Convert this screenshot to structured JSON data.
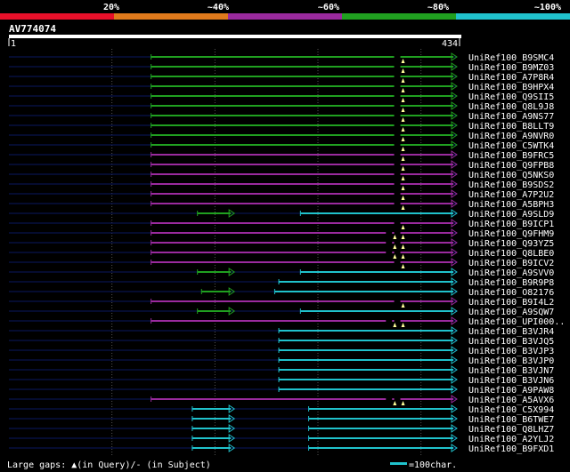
{
  "scale": {
    "labels": [
      "20%",
      "~40%",
      "~60%",
      "~80%",
      "~100%"
    ],
    "colors": [
      "#e8102a",
      "#e07a1c",
      "#9a2a9e",
      "#20a020",
      "#20c2cc"
    ]
  },
  "query": {
    "name": "AV774074",
    "start": "1",
    "end": "434",
    "length": 434
  },
  "colors": {
    "background": "#000000",
    "query_bar": "#ffffff",
    "unaligned": "#0a1860",
    "grid": "#555555",
    "gap_marker": "#ffff99",
    "green": "#20a020",
    "purple": "#9a2a9e",
    "cyan": "#20c2cc"
  },
  "hits": [
    {
      "name": "UniRef100_B9SMC4",
      "color": "green",
      "segs": [
        [
          138,
          434
        ]
      ],
      "gaps": [
        380
      ]
    },
    {
      "name": "UniRef100_B9MZ03",
      "color": "green",
      "segs": [
        [
          138,
          434
        ]
      ],
      "gaps": [
        380
      ]
    },
    {
      "name": "UniRef100_A7P8R4",
      "color": "green",
      "segs": [
        [
          138,
          434
        ]
      ],
      "gaps": [
        380
      ]
    },
    {
      "name": "UniRef100_B9HPX4",
      "color": "green",
      "segs": [
        [
          138,
          434
        ]
      ],
      "gaps": [
        380
      ]
    },
    {
      "name": "UniRef100_Q9SII5",
      "color": "green",
      "segs": [
        [
          138,
          434
        ]
      ],
      "gaps": [
        380
      ]
    },
    {
      "name": "UniRef100_Q8L9J8",
      "color": "green",
      "segs": [
        [
          138,
          434
        ]
      ],
      "gaps": [
        380
      ]
    },
    {
      "name": "UniRef100_A9NS77",
      "color": "green",
      "segs": [
        [
          138,
          434
        ]
      ],
      "gaps": [
        380
      ]
    },
    {
      "name": "UniRef100_B8LLT9",
      "color": "green",
      "segs": [
        [
          138,
          434
        ]
      ],
      "gaps": [
        380
      ]
    },
    {
      "name": "UniRef100_A9NVR0",
      "color": "green",
      "segs": [
        [
          138,
          434
        ]
      ],
      "gaps": [
        380
      ]
    },
    {
      "name": "UniRef100_C5WTK4",
      "color": "green",
      "segs": [
        [
          138,
          434
        ]
      ],
      "gaps": [
        380
      ]
    },
    {
      "name": "UniRef100_B9FRC5",
      "color": "purple",
      "segs": [
        [
          138,
          434
        ]
      ],
      "gaps": [
        380
      ]
    },
    {
      "name": "UniRef100_Q9FPB8",
      "color": "purple",
      "segs": [
        [
          138,
          434
        ]
      ],
      "gaps": [
        380
      ]
    },
    {
      "name": "UniRef100_Q5NKS0",
      "color": "purple",
      "segs": [
        [
          138,
          434
        ]
      ],
      "gaps": [
        380
      ]
    },
    {
      "name": "UniRef100_B9SDS2",
      "color": "purple",
      "segs": [
        [
          138,
          434
        ]
      ],
      "gaps": [
        380
      ]
    },
    {
      "name": "UniRef100_A7P2U2",
      "color": "purple",
      "segs": [
        [
          138,
          434
        ]
      ],
      "gaps": [
        380
      ]
    },
    {
      "name": "UniRef100_A5BPH3",
      "color": "purple",
      "segs": [
        [
          138,
          434
        ]
      ],
      "gaps": [
        380
      ]
    },
    {
      "name": "UniRef100_A9SLD9",
      "color": "cyan",
      "segs": [
        [
          283,
          434
        ]
      ],
      "gaps": [],
      "extra": {
        "color": "green",
        "from": 183,
        "to": 218
      }
    },
    {
      "name": "UniRef100_B9ICP1",
      "color": "purple",
      "segs": [
        [
          138,
          434
        ]
      ],
      "gaps": [
        380
      ]
    },
    {
      "name": "UniRef100_Q9FHM9",
      "color": "purple",
      "segs": [
        [
          138,
          434
        ]
      ],
      "gaps": [
        372,
        380
      ]
    },
    {
      "name": "UniRef100_Q93YZ5",
      "color": "purple",
      "segs": [
        [
          138,
          434
        ]
      ],
      "gaps": [
        372,
        380
      ]
    },
    {
      "name": "UniRef100_Q8LBE0",
      "color": "purple",
      "segs": [
        [
          138,
          434
        ]
      ],
      "gaps": [
        372,
        380
      ]
    },
    {
      "name": "UniRef100_B9ICV2",
      "color": "purple",
      "segs": [
        [
          138,
          434
        ]
      ],
      "gaps": [
        380
      ]
    },
    {
      "name": "UniRef100_A9SVV0",
      "color": "cyan",
      "segs": [
        [
          283,
          434
        ]
      ],
      "gaps": [],
      "extra": {
        "color": "green",
        "from": 183,
        "to": 218
      }
    },
    {
      "name": "UniRef100_B9R9P8",
      "color": "cyan",
      "segs": [
        [
          262,
          434
        ]
      ],
      "gaps": []
    },
    {
      "name": "UniRef100_O82176",
      "color": "cyan",
      "segs": [
        [
          258,
          434
        ]
      ],
      "gaps": [],
      "extra": {
        "color": "green",
        "from": 187,
        "to": 218
      }
    },
    {
      "name": "UniRef100_B9I4L2",
      "color": "purple",
      "segs": [
        [
          138,
          434
        ]
      ],
      "gaps": [
        380
      ]
    },
    {
      "name": "UniRef100_A9SQW7",
      "color": "cyan",
      "segs": [
        [
          283,
          434
        ]
      ],
      "gaps": [],
      "extra": {
        "color": "green",
        "from": 183,
        "to": 218
      }
    },
    {
      "name": "UniRef100_UPI000..",
      "color": "purple",
      "segs": [
        [
          138,
          434
        ]
      ],
      "gaps": [
        372,
        380
      ]
    },
    {
      "name": "UniRef100_B3VJR4",
      "color": "cyan",
      "segs": [
        [
          262,
          434
        ]
      ],
      "gaps": []
    },
    {
      "name": "UniRef100_B3VJQ5",
      "color": "cyan",
      "segs": [
        [
          262,
          434
        ]
      ],
      "gaps": []
    },
    {
      "name": "UniRef100_B3VJP3",
      "color": "cyan",
      "segs": [
        [
          262,
          434
        ]
      ],
      "gaps": []
    },
    {
      "name": "UniRef100_B3VJP0",
      "color": "cyan",
      "segs": [
        [
          262,
          434
        ]
      ],
      "gaps": []
    },
    {
      "name": "UniRef100_B3VJN7",
      "color": "cyan",
      "segs": [
        [
          262,
          434
        ]
      ],
      "gaps": []
    },
    {
      "name": "UniRef100_B3VJN6",
      "color": "cyan",
      "segs": [
        [
          262,
          434
        ]
      ],
      "gaps": []
    },
    {
      "name": "UniRef100_A9PAW8",
      "color": "cyan",
      "segs": [
        [
          262,
          434
        ]
      ],
      "gaps": []
    },
    {
      "name": "UniRef100_A5AVX6",
      "color": "purple",
      "segs": [
        [
          138,
          434
        ]
      ],
      "gaps": [
        372,
        380
      ]
    },
    {
      "name": "UniRef100_C5X994",
      "color": "cyan",
      "segs": [
        [
          178,
          218
        ],
        [
          291,
          434
        ]
      ],
      "gaps": []
    },
    {
      "name": "UniRef100_B6TWE7",
      "color": "cyan",
      "segs": [
        [
          178,
          218
        ],
        [
          291,
          434
        ]
      ],
      "gaps": []
    },
    {
      "name": "UniRef100_Q8LHZ7",
      "color": "cyan",
      "segs": [
        [
          178,
          218
        ],
        [
          291,
          434
        ]
      ],
      "gaps": []
    },
    {
      "name": "UniRef100_A2YLJ2",
      "color": "cyan",
      "segs": [
        [
          178,
          218
        ],
        [
          291,
          434
        ]
      ],
      "gaps": []
    },
    {
      "name": "UniRef100_B9FXD1",
      "color": "cyan",
      "segs": [
        [
          178,
          218
        ],
        [
          291,
          434
        ]
      ],
      "gaps": []
    }
  ],
  "footer": {
    "gaps_text": "Large gaps: ▲(in Query)/- (in Subject)",
    "legend_text": "=100char."
  }
}
